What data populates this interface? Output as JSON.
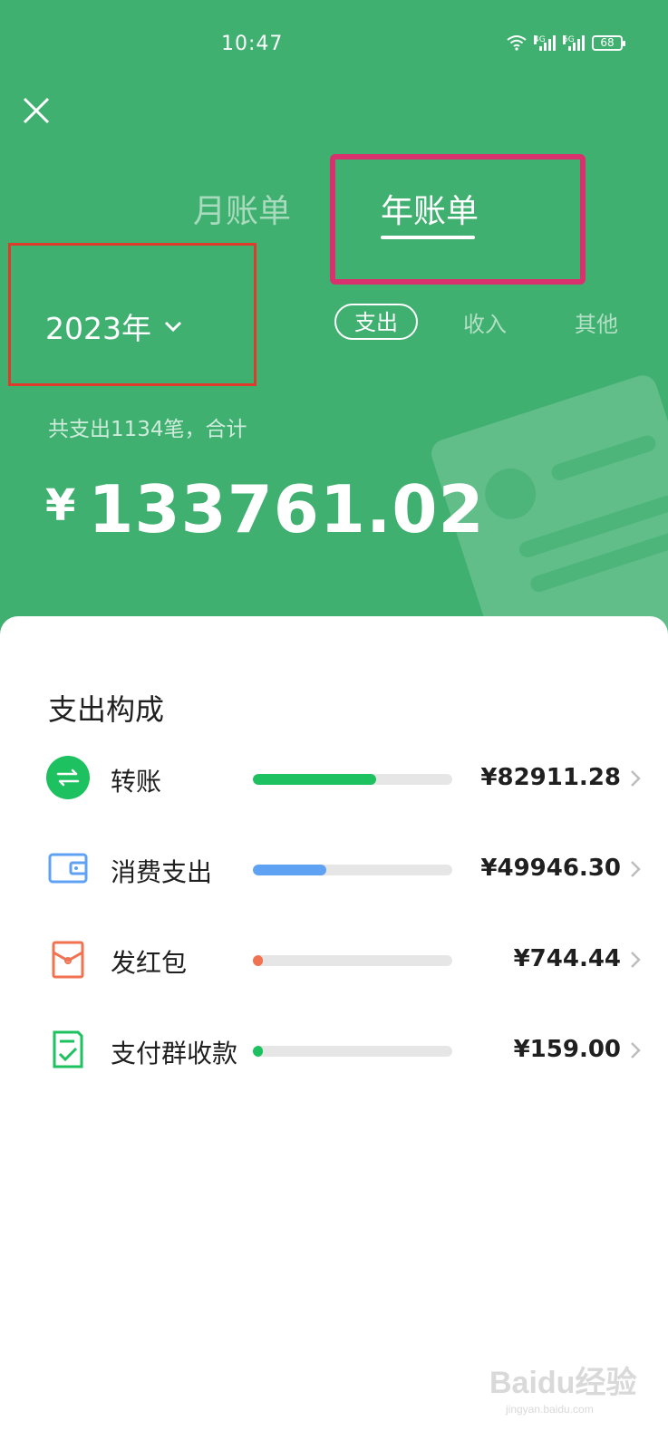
{
  "status_bar": {
    "time": "10:47",
    "network_1": "4G",
    "network_2": "5G",
    "battery": "68"
  },
  "header": {
    "close_icon": "close-icon",
    "tabs": [
      {
        "label": "月账单",
        "active": false
      },
      {
        "label": "年账单",
        "active": true
      }
    ],
    "year_select": "2023年",
    "filters": [
      {
        "label": "支出",
        "active": true
      },
      {
        "label": "收入",
        "active": false
      },
      {
        "label": "其他",
        "active": false
      }
    ],
    "summary": "共支出1134笔，合计",
    "currency": "¥",
    "total": "133761.02",
    "bg_color": "#3fb06f",
    "annotation_colors": [
      "#d9316e",
      "#e03a2a"
    ]
  },
  "breakdown": {
    "title": "支出构成",
    "items": [
      {
        "label": "转账",
        "value": "¥82911.28",
        "fraction": 0.62,
        "color": "#1ec15f",
        "icon": "transfer-icon"
      },
      {
        "label": "消费支出",
        "value": "¥49946.30",
        "fraction": 0.37,
        "color": "#5fa2f4",
        "icon": "wallet-icon"
      },
      {
        "label": "发红包",
        "value": "¥744.44",
        "fraction": 0.04,
        "color": "#f07250",
        "icon": "red-packet-icon"
      },
      {
        "label": "支付群收款",
        "value": "¥159.00",
        "fraction": 0.04,
        "color": "#1ec15f",
        "icon": "group-collect-icon"
      }
    ]
  },
  "watermark": {
    "text": "Baidu经验",
    "url": "jingyan.baidu.com"
  }
}
